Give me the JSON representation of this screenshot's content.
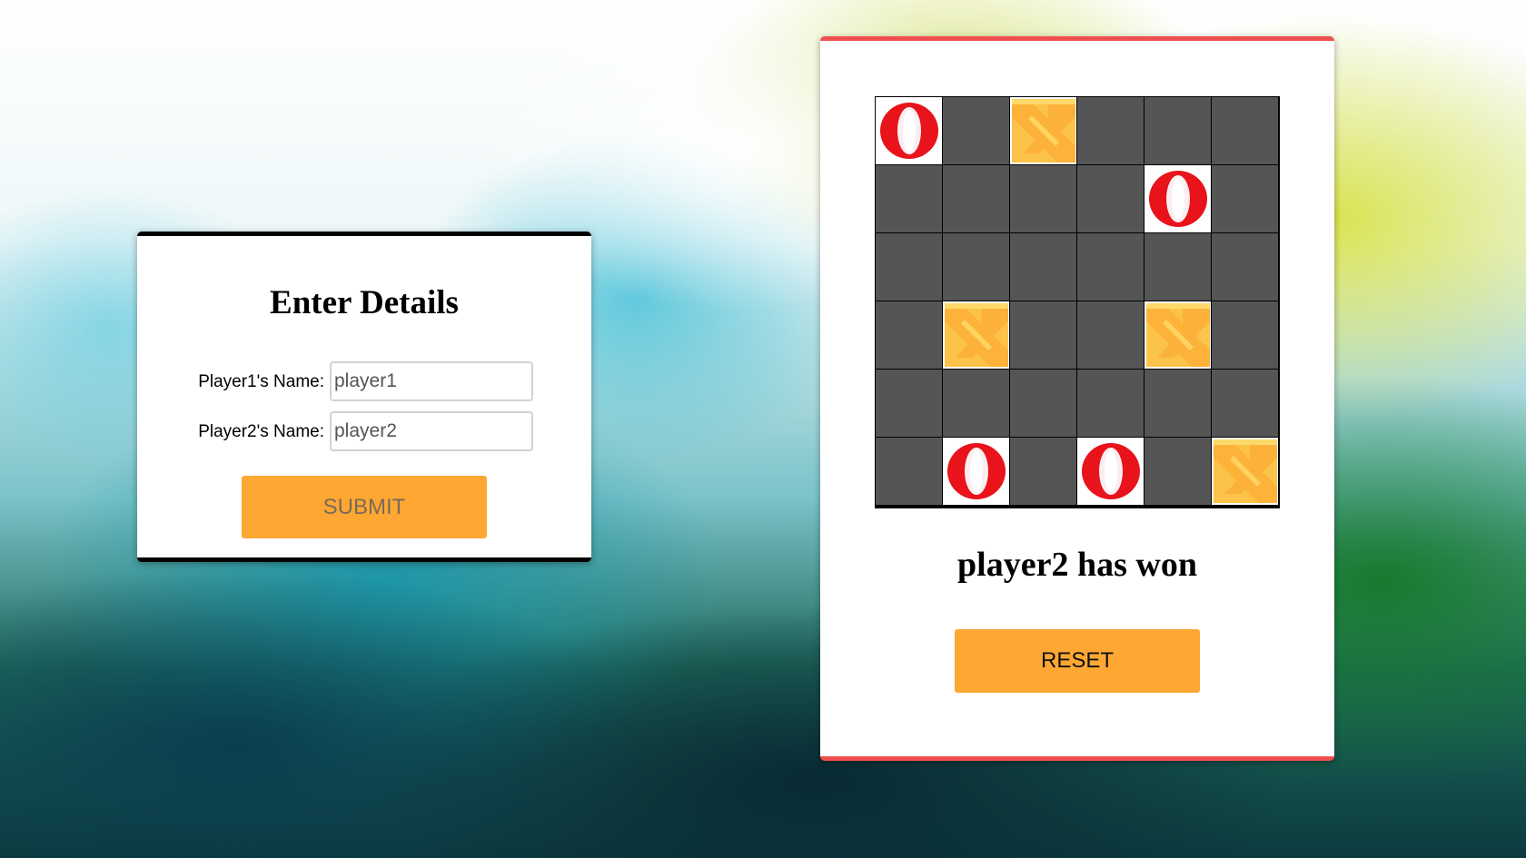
{
  "details": {
    "title": "Enter Details",
    "player1_label": "Player1's Name:",
    "player1_value": "player1",
    "player2_label": "Player2's Name:",
    "player2_value": "player2",
    "submit_label": "SUBMIT"
  },
  "game": {
    "board": [
      [
        "O",
        "",
        "X",
        "",
        "",
        ""
      ],
      [
        "",
        "",
        "",
        "",
        "O",
        ""
      ],
      [
        "",
        "",
        "",
        "",
        "",
        ""
      ],
      [
        "",
        "X",
        "",
        "",
        "X",
        ""
      ],
      [
        "",
        "",
        "",
        "",
        "",
        ""
      ],
      [
        "",
        "O",
        "",
        "O",
        "",
        "X"
      ]
    ],
    "status": "player2 has won",
    "reset_label": "RESET"
  },
  "colors": {
    "accent_button": "#ffa733",
    "empty_cell": "#555555",
    "game_panel_border": "#ef4f4f",
    "details_panel_border": "#000000"
  }
}
